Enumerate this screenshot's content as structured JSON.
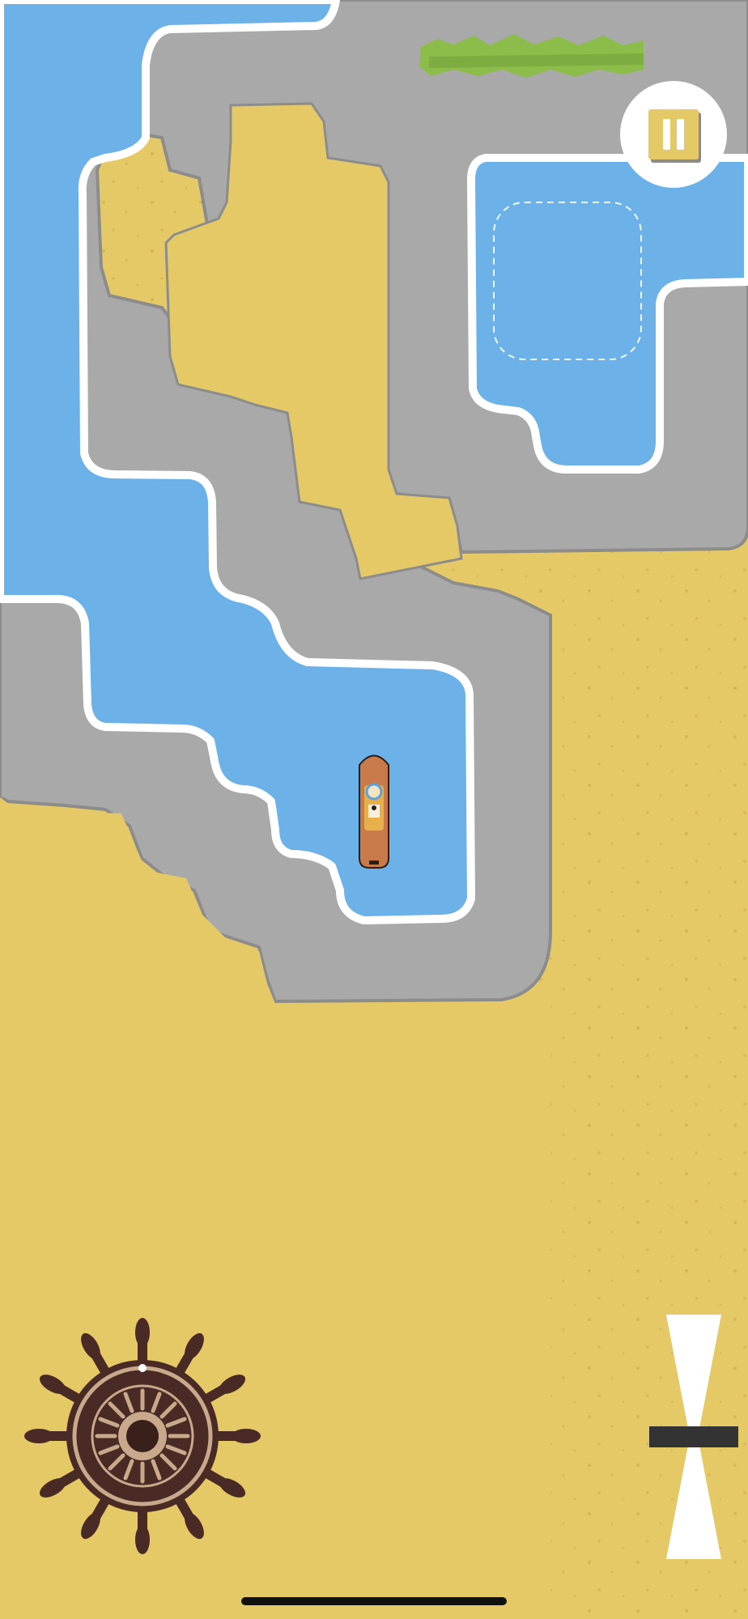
{
  "game": {
    "screen": "level-play",
    "colors": {
      "sand": "#e6c967",
      "sand_speck": "#c8a94e",
      "road": "#a9a9a9",
      "road_edge": "#8c8c8c",
      "water": "#6cb2e8",
      "shore": "#ffffff",
      "grass": "#8cbc4a",
      "boat_hull": "#c97a4a",
      "boat_deck": "#e8b04a",
      "wheel_dark": "#4a2a24",
      "wheel_light": "#c9a98b"
    },
    "map": {
      "target_zone": "dashed-outline-parking-spot",
      "player": "boat"
    },
    "controls": {
      "pause_icon": "pause-icon",
      "steering_icon": "ship-wheel-icon",
      "throttle_icon": "hourglass-throttle-icon",
      "throttle_level": 0.5
    }
  }
}
